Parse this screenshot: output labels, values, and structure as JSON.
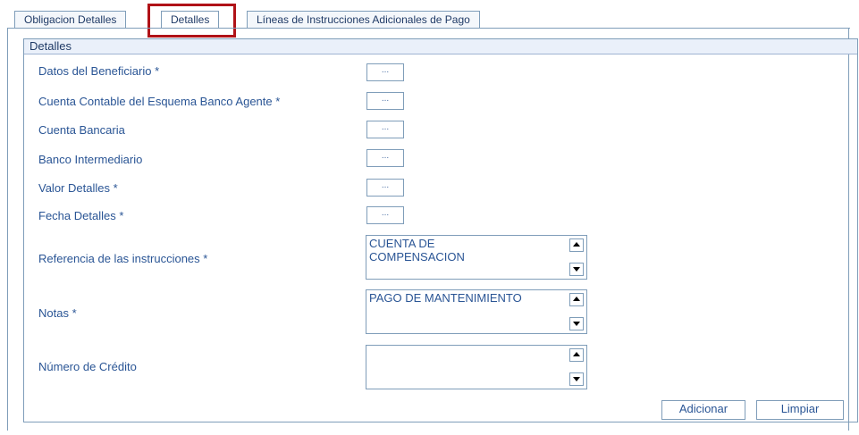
{
  "tabs": [
    {
      "label": "Obligacion Detalles"
    },
    {
      "label": "Detalles"
    },
    {
      "label": "Líneas de Instrucciones Adicionales de Pago"
    }
  ],
  "active_tab": "Detalles",
  "panel": {
    "title": "Detalles"
  },
  "fields": {
    "datos_beneficiario": {
      "label": "Datos del Beneficiario *",
      "button": "..."
    },
    "cuenta_contable": {
      "label": "Cuenta Contable del Esquema Banco Agente *",
      "button": "..."
    },
    "cuenta_bancaria": {
      "label": "Cuenta Bancaria",
      "button": "..."
    },
    "banco_intermediario": {
      "label": "Banco Intermediario",
      "button": "..."
    },
    "valor_detalles": {
      "label": "Valor Detalles *",
      "button": "..."
    },
    "fecha_detalles": {
      "label": "Fecha Detalles *",
      "button": "..."
    },
    "referencia": {
      "label": "Referencia de las instrucciones *",
      "value": "CUENTA DE\nCOMPENSACION"
    },
    "notas": {
      "label": "Notas *",
      "value": "PAGO DE MANTENIMIENTO"
    },
    "numero_credito": {
      "label": "Número de Crédito",
      "value": ""
    }
  },
  "buttons": {
    "adicionar": "Adicionar",
    "limpiar": "Limpiar"
  },
  "colors": {
    "highlight": "#b01217",
    "label_text": "#2a5595",
    "border": "#7f9db9"
  }
}
